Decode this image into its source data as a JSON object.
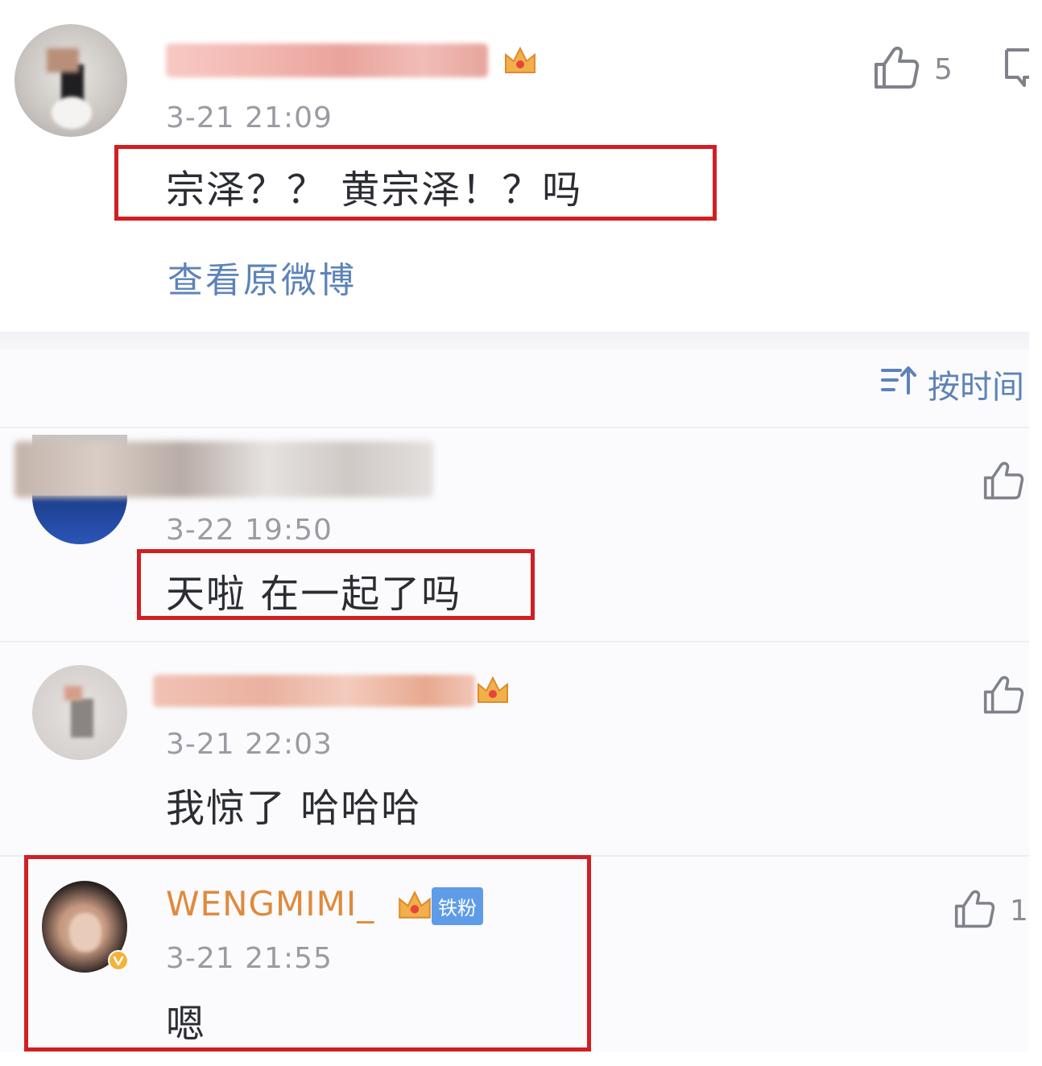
{
  "comments_top": {
    "timestamp": "3-21 21:09",
    "text": "宗泽？？ 黄宗泽！？吗",
    "likes": "5",
    "view_original": "查看原微博"
  },
  "sort": {
    "label": "按时间"
  },
  "comments": [
    {
      "timestamp": "3-22 19:50",
      "text": "天啦 在一起了吗"
    },
    {
      "timestamp": "3-21 22:03",
      "text": "我惊了 哈哈哈"
    },
    {
      "username": "WENGMIMI_",
      "fan_badge": "铁粉",
      "timestamp": "3-21 21:55",
      "text": "嗯",
      "likes": "1"
    }
  ],
  "colors": {
    "highlight": "#d11f23",
    "link": "#5d83b8",
    "username": "#e08a3c",
    "badge": "#5e9ce8"
  }
}
